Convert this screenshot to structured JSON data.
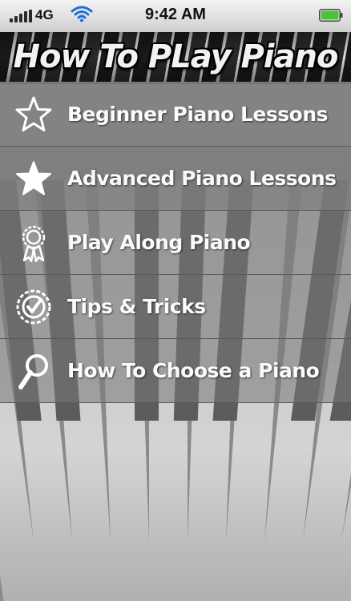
{
  "status_bar": {
    "carrier": "4G",
    "time": "9:42 AM",
    "icons": [
      "signal-icon",
      "wifi-icon",
      "battery-icon"
    ]
  },
  "header": {
    "title": "How To PLay Piano"
  },
  "menu": {
    "items": [
      {
        "label": "Beginner Piano Lessons",
        "icon": "star-outline-icon"
      },
      {
        "label": "Advanced Piano Lessons",
        "icon": "star-filled-icon"
      },
      {
        "label": "Play Along Piano",
        "icon": "award-ribbon-icon"
      },
      {
        "label": "Tips & Tricks",
        "icon": "check-badge-icon"
      },
      {
        "label": "How To Choose a Piano",
        "icon": "magnifier-icon"
      }
    ]
  },
  "colors": {
    "battery": "#4cc23a",
    "text": "#fbfbfb",
    "background": "#8e8e8e"
  }
}
